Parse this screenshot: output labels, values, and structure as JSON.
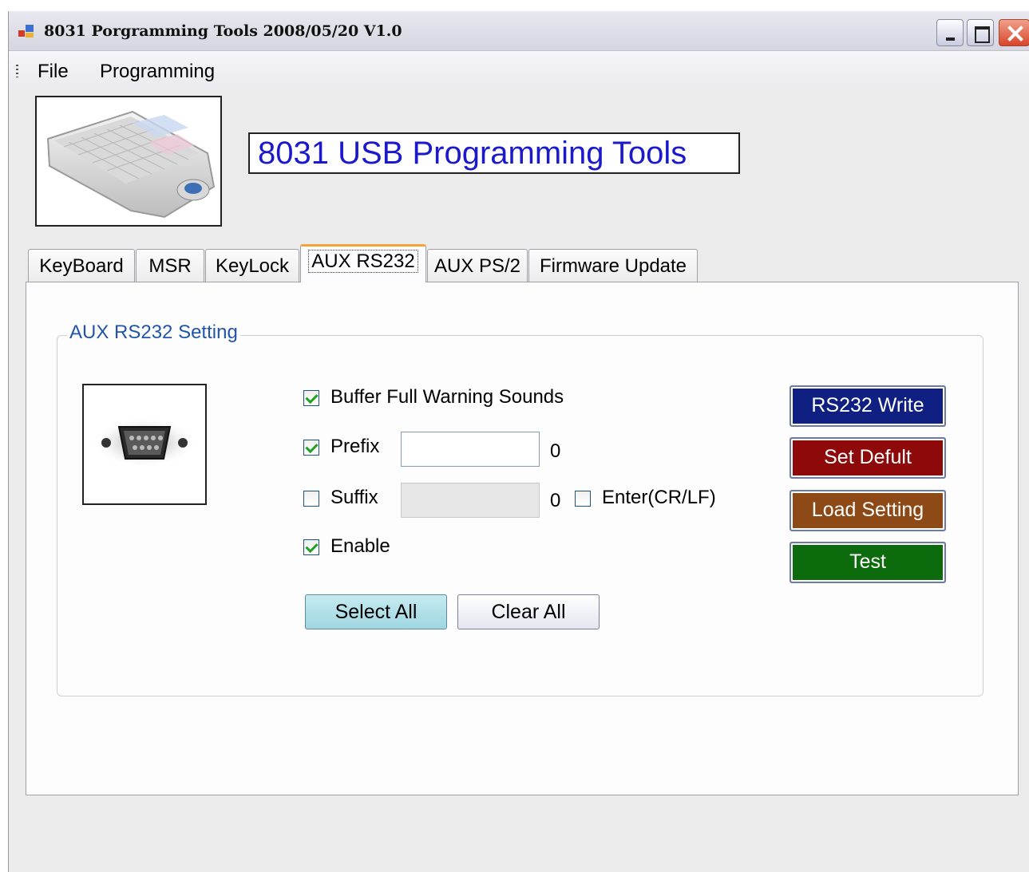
{
  "window": {
    "title": "8031 Porgramming Tools 2008/05/20 V1.0"
  },
  "menu": {
    "items": [
      "File",
      "Programming"
    ]
  },
  "header": {
    "title": "8031 USB Programming Tools"
  },
  "tabs": [
    {
      "label": "KeyBoard",
      "active": false
    },
    {
      "label": "MSR",
      "active": false
    },
    {
      "label": "KeyLock",
      "active": false
    },
    {
      "label": "AUX RS232",
      "active": true
    },
    {
      "label": "AUX PS/2",
      "active": false
    },
    {
      "label": "Firmware Update",
      "active": false
    }
  ],
  "group": {
    "title": "AUX RS232 Setting",
    "buffer_full": {
      "label": "Buffer Full Warning Sounds",
      "checked": true
    },
    "prefix": {
      "label": "Prefix",
      "checked": true,
      "value": "",
      "count": "0"
    },
    "suffix": {
      "label": "Suffix",
      "checked": false,
      "value": "",
      "count": "0",
      "enabled": false
    },
    "enter_crlf": {
      "label": "Enter(CR/LF)",
      "checked": false
    },
    "enable": {
      "label": "Enable",
      "checked": true
    },
    "select_all_label": "Select All",
    "clear_all_label": "Clear All"
  },
  "actions": {
    "write": {
      "label": "RS232 Write",
      "color": "#101f82"
    },
    "set_default": {
      "label": "Set Defult",
      "color": "#8e0a0a"
    },
    "load_setting": {
      "label": "Load Setting",
      "color": "#8d4a16"
    },
    "test": {
      "label": "Test",
      "color": "#0c6b0c"
    }
  },
  "colors": {
    "heading_text": "#1a1acc",
    "group_title": "#2255aa",
    "active_tab_accent": "#f5a43a"
  }
}
